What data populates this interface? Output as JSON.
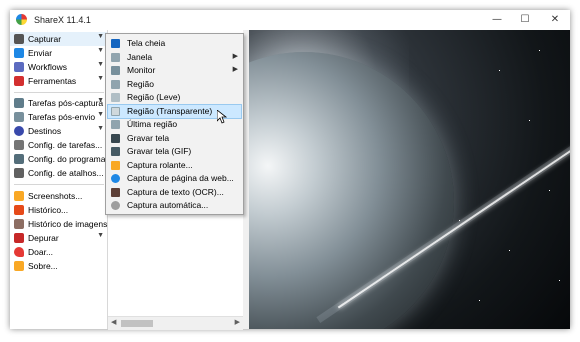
{
  "window": {
    "title": "ShareX 11.4.1",
    "minimize_glyph": "—",
    "maximize_glyph": "☐",
    "close_glyph": "✕"
  },
  "sidebar": {
    "items": [
      {
        "label": "Capturar",
        "icon": "camera-icon",
        "has_submenu": true,
        "color": "#555555"
      },
      {
        "label": "Enviar",
        "icon": "upload-arrow-icon",
        "has_submenu": true,
        "color": "#1e88e5"
      },
      {
        "label": "Workflows",
        "icon": "workflow-grid-icon",
        "has_submenu": true,
        "color": "#5c6bc0"
      },
      {
        "label": "Ferramentas",
        "icon": "toolbox-icon",
        "has_submenu": true,
        "color": "#d32f2f"
      },
      {
        "label": "Tarefas pós-captura",
        "icon": "image-task-icon",
        "has_submenu": true,
        "color": "#607d8b"
      },
      {
        "label": "Tarefas pós-envio",
        "icon": "cloud-task-icon",
        "has_submenu": true,
        "color": "#78909c"
      },
      {
        "label": "Destinos",
        "icon": "globe-icon",
        "has_submenu": true,
        "color": "#3949ab"
      },
      {
        "label": "Config. de tarefas...",
        "icon": "wrench-icon",
        "has_submenu": false,
        "color": "#757575"
      },
      {
        "label": "Config. do programa...",
        "icon": "settings-icon",
        "has_submenu": false,
        "color": "#546e7a"
      },
      {
        "label": "Config. de atalhos...",
        "icon": "keyboard-icon",
        "has_submenu": false,
        "color": "#616161"
      },
      {
        "label": "Screenshots...",
        "icon": "folder-icon",
        "has_submenu": false,
        "color": "#f9a825"
      },
      {
        "label": "Histórico...",
        "icon": "history-book-icon",
        "has_submenu": false,
        "color": "#e64a19"
      },
      {
        "label": "Histórico de imagens...",
        "icon": "image-history-icon",
        "has_submenu": false,
        "color": "#8d6e63"
      },
      {
        "label": "Depurar",
        "icon": "bug-icon",
        "has_submenu": true,
        "color": "#c62828"
      },
      {
        "label": "Doar...",
        "icon": "heart-icon",
        "has_submenu": false,
        "color": "#e53935"
      },
      {
        "label": "Sobre...",
        "icon": "crown-icon",
        "has_submenu": false,
        "color": "#f9a825"
      }
    ]
  },
  "capture_menu": {
    "items": [
      {
        "label": "Tela cheia",
        "icon": "fullscreen-icon",
        "has_submenu": false,
        "color": "#1565c0"
      },
      {
        "label": "Janela",
        "icon": "window-icon",
        "has_submenu": true,
        "color": "#90a4ae"
      },
      {
        "label": "Monitor",
        "icon": "monitor-icon",
        "has_submenu": true,
        "color": "#78909c"
      },
      {
        "label": "Região",
        "icon": "region-icon",
        "has_submenu": false,
        "color": "#90a4ae"
      },
      {
        "label": "Região (Leve)",
        "icon": "region-light-icon",
        "has_submenu": false,
        "color": "#b0bec5"
      },
      {
        "label": "Região (Transparente)",
        "icon": "region-transparent-icon",
        "has_submenu": false,
        "color": "#cfd8dc"
      },
      {
        "label": "Última região",
        "icon": "last-region-icon",
        "has_submenu": false,
        "color": "#90a4ae"
      },
      {
        "label": "Gravar tela",
        "icon": "record-screen-icon",
        "has_submenu": false,
        "color": "#37474f"
      },
      {
        "label": "Gravar tela (GIF)",
        "icon": "record-gif-icon",
        "has_submenu": false,
        "color": "#455a64"
      },
      {
        "label": "Captura rolante...",
        "icon": "scrolling-capture-icon",
        "has_submenu": false,
        "color": "#f9a825"
      },
      {
        "label": "Captura de página da web...",
        "icon": "web-capture-icon",
        "has_submenu": false,
        "color": "#1e88e5"
      },
      {
        "label": "Captura de texto (OCR)...",
        "icon": "ocr-icon",
        "has_submenu": false,
        "color": "#5d4037"
      },
      {
        "label": "Captura automática...",
        "icon": "clock-icon",
        "has_submenu": false,
        "color": "#9e9e9e"
      }
    ],
    "highlighted_index": 5
  },
  "scrollbar": {
    "left_arrow": "◀",
    "right_arrow": "▶"
  },
  "colors": {
    "highlight": "#cce8ff",
    "highlight_border": "#99c9ef",
    "menu_bg": "#f2f2f2"
  }
}
